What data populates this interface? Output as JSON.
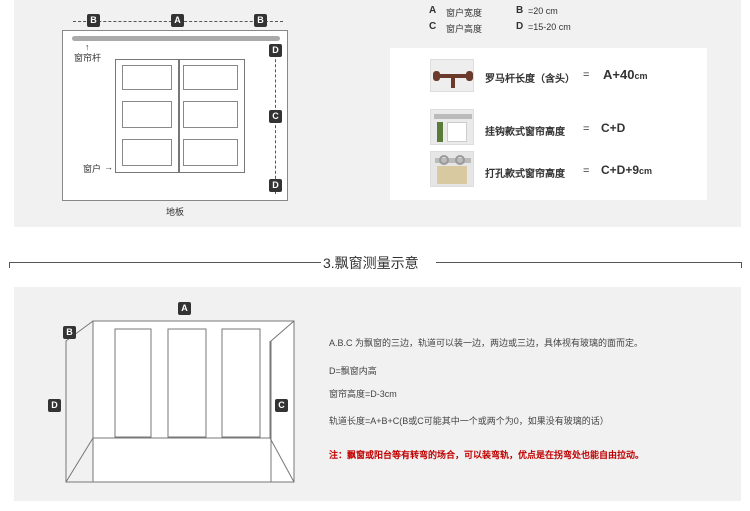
{
  "top_diagram": {
    "labels": {
      "a": "A",
      "b": "B",
      "c": "C",
      "d": "D"
    },
    "rod_label": "窗帘杆",
    "window_label": "窗户",
    "floor_label": "地板"
  },
  "legend": [
    {
      "key": "A",
      "text": "窗户宽度"
    },
    {
      "key": "B",
      "text": "=20 cm"
    },
    {
      "key": "C",
      "text": "窗户高度"
    },
    {
      "key": "D",
      "text": "=15-20 cm"
    }
  ],
  "formulas": [
    {
      "title": "罗马杆长度（含头）",
      "eq": "=",
      "value_main": "A+40",
      "value_unit": "cm"
    },
    {
      "title": "挂钩款式窗帘高度",
      "eq": "=",
      "value_main": "C+D",
      "value_unit": ""
    },
    {
      "title": "打孔款式窗帘高度",
      "eq": "=",
      "value_main": "C+D+9",
      "value_unit": "cm"
    }
  ],
  "section_title": "3.飘窗测量示意",
  "bay": {
    "labels": {
      "a": "A",
      "b": "B",
      "c": "C",
      "d": "D"
    },
    "notes": [
      "A.B.C 为飘窗的三边，轨道可以装一边，两边或三边，具体视有玻璃的面而定。",
      "D=飘窗内高",
      "窗帘高度=D-3cm",
      "轨道长度=A+B+C(B或C可能其中一个或两个为0，如果没有玻璃的话）"
    ],
    "warning": "注：飘窗或阳台等有转弯的场合，可以装弯轨，优点是在拐弯处也能自由拉动。",
    "warning_color": "#c00000"
  }
}
